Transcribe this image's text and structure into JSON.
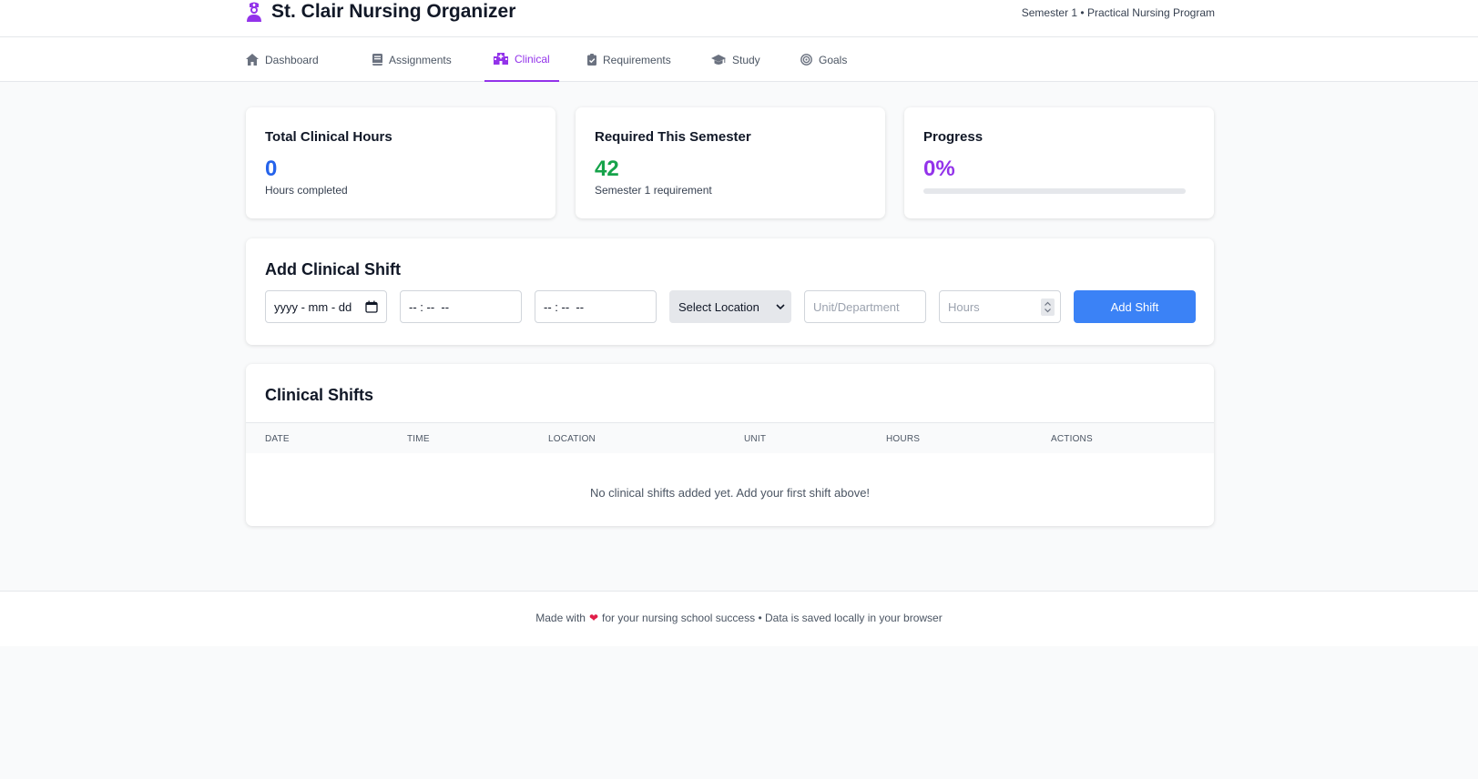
{
  "header": {
    "title": "St. Clair Nursing Organizer",
    "logo_icon": "nurse-icon",
    "semester_info": "Semester 1 • Practical Nursing Program"
  },
  "nav": {
    "tabs": [
      {
        "label": "Dashboard",
        "icon": "home-icon"
      },
      {
        "label": "Assignments",
        "icon": "book-icon"
      },
      {
        "label": "Clinical",
        "icon": "hospital-icon",
        "active": true
      },
      {
        "label": "Requirements",
        "icon": "clipboard-check-icon"
      },
      {
        "label": "Study",
        "icon": "graduation-cap-icon"
      },
      {
        "label": "Goals",
        "icon": "target-icon"
      }
    ]
  },
  "stats": {
    "total": {
      "title": "Total Clinical Hours",
      "value": "0",
      "sub": "Hours completed"
    },
    "required": {
      "title": "Required This Semester",
      "value": "42",
      "sub": "Semester 1 requirement"
    },
    "progress": {
      "title": "Progress",
      "value": "0%",
      "fraction": 0
    }
  },
  "add_shift": {
    "title": "Add Clinical Shift",
    "date_value": "yyyy - mm - dd",
    "start_time_value": "-- : --  --",
    "end_time_value": "-- : --  --",
    "location_selected": "Select Location",
    "unit_placeholder": "Unit/Department",
    "hours_placeholder": "Hours",
    "button_label": "Add Shift"
  },
  "shifts": {
    "title": "Clinical Shifts",
    "columns": [
      "Date",
      "Time",
      "Location",
      "Unit",
      "Hours",
      "Actions"
    ],
    "empty_message": "No clinical shifts added yet. Add your first shift above!"
  },
  "footer": {
    "before": "Made with",
    "after": "for your nursing school success • Data is saved locally in your browser"
  },
  "colors": {
    "accent_purple": "#9333ea",
    "blue_value": "#2563eb",
    "green_value": "#16a34a",
    "button_blue": "#3b82f6",
    "heart": "#e11d48"
  }
}
